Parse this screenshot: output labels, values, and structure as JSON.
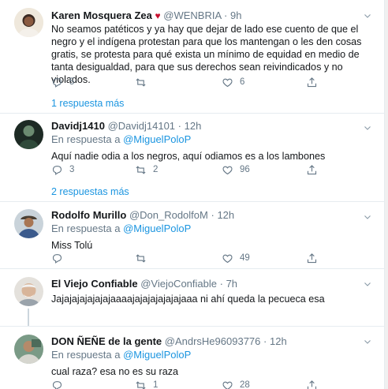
{
  "tweets": [
    {
      "name": "Karen Mosquera Zea",
      "badge": "♥",
      "handle": "@WENBRIA",
      "sep": "·",
      "time": "9h",
      "reply_label": "",
      "mention": "",
      "text": "No seamos patéticos y ya hay que dejar de lado ese cuento de que el negro y el indígena protestan para que los mantengan o les den cosas gratis, se protesta para qué exista un mínimo de equidad en medio de tanta desigualdad, para que sus derechos sean reivindicados y no violados.",
      "replies": "5",
      "retweets": "",
      "likes": "6",
      "more": "1 respuesta más"
    },
    {
      "name": "Davidj1410",
      "handle": "@Davidj14101",
      "sep": "·",
      "time": "12h",
      "reply_label": "En respuesta a",
      "mention": "@MiguelPoloP",
      "text": "Aquí nadie odia a los negros, aquí odiamos es a los lambones",
      "replies": "3",
      "retweets": "2",
      "likes": "96",
      "more": "2 respuestas más"
    },
    {
      "name": "Rodolfo Murillo",
      "handle": "@Don_RodolfoM",
      "sep": "·",
      "time": "12h",
      "reply_label": "En respuesta a",
      "mention": "@MiguelPoloP",
      "text": "Miss Tolú",
      "replies": "",
      "retweets": "",
      "likes": "49"
    },
    {
      "name": "El Viejo Confiable",
      "handle": "@ViejoConfiable",
      "sep": "·",
      "time": "7h",
      "reply_label": "",
      "mention": "",
      "text": "Jajajajajajajajaaaajajajajajajajaaa ni ahí queda la pecueca esa"
    },
    {
      "name": "DON ÑEÑE de la gente",
      "handle": "@AndrsHe96093776",
      "sep": "·",
      "time": "12h",
      "reply_label": "En respuesta a",
      "mention": "@MiguelPoloP",
      "text": "cual raza? esa no es su raza",
      "replies": "",
      "retweets": "1",
      "likes": "28"
    }
  ],
  "colors": {
    "link": "#1b95e0",
    "muted": "#657786",
    "text": "#14171a",
    "divider": "#e6ecf0",
    "heart": "#c8102e"
  },
  "icons": [
    "reply-icon",
    "retweet-icon",
    "like-icon",
    "share-icon",
    "caret-down-icon"
  ]
}
